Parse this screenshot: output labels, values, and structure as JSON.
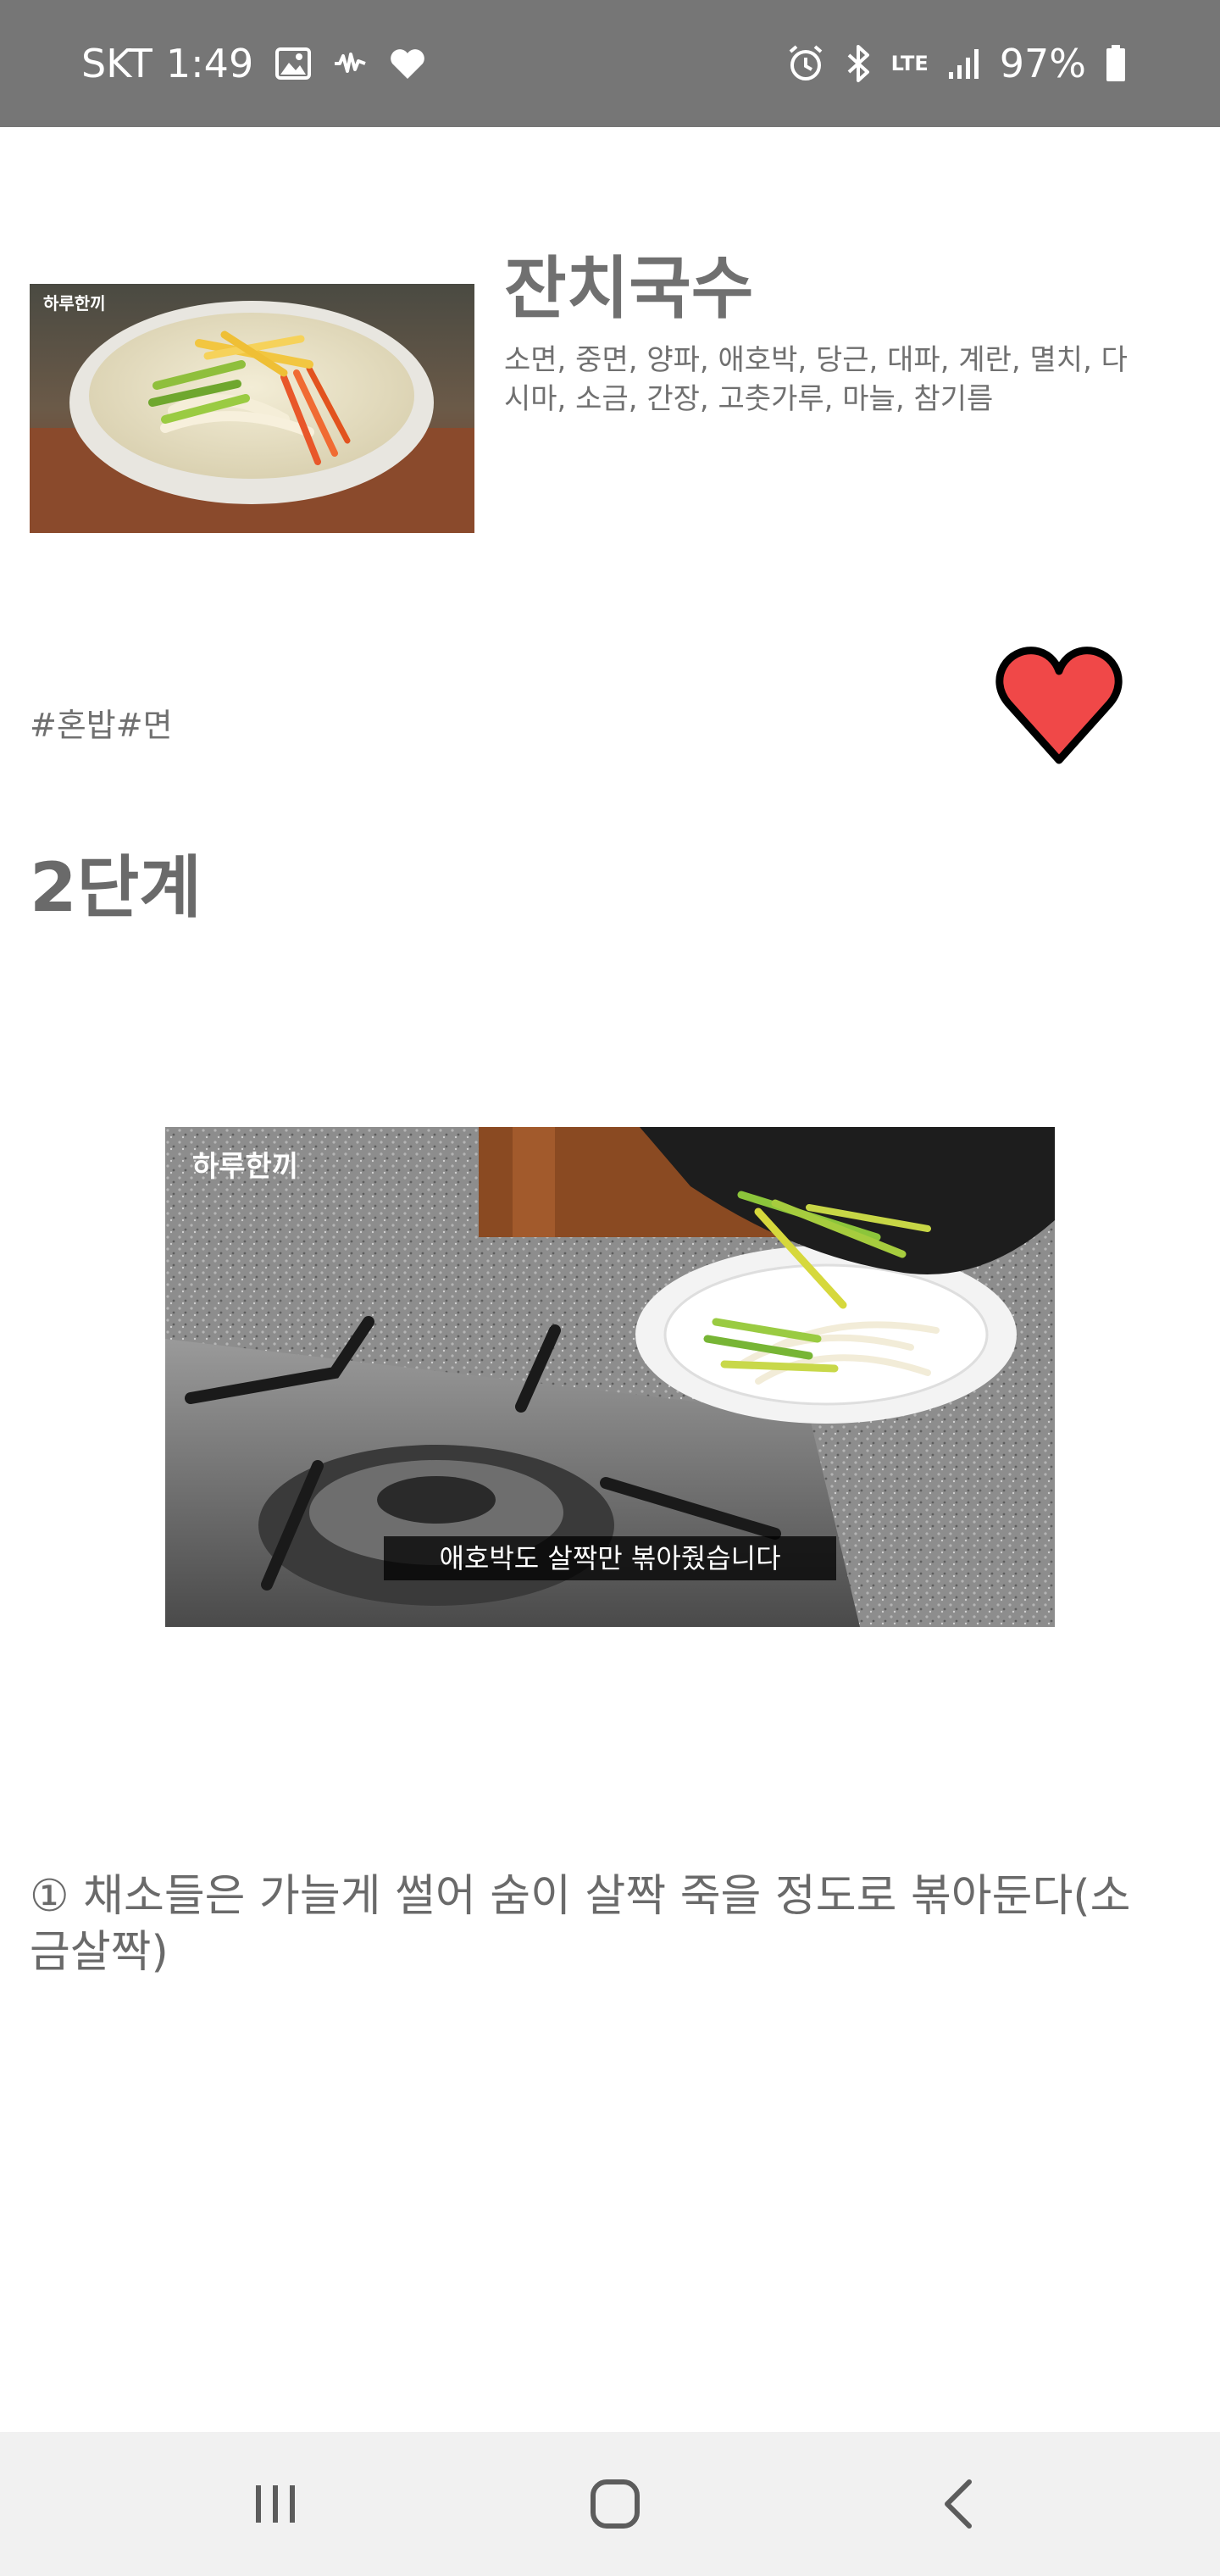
{
  "status_bar": {
    "carrier": "SKT",
    "time": "1:49",
    "lte": "LTE",
    "battery": "97%"
  },
  "recipe": {
    "title": "잔치국수",
    "ingredients": "소면, 중면, 양파, 애호박, 당근, 대파, 계란, 멸치, 다시마, 소금, 간장, 고춧가루, 마늘, 참기름",
    "thumbnail_watermark": "하루한끼",
    "tags": "#혼밥#면",
    "favorite_color": "#f04848"
  },
  "step": {
    "title": "2단계",
    "image_watermark": "하루한끼",
    "image_caption": "애호박도 살짝만 볶아줬습니다",
    "instruction": "① 채소들은 가늘게 썰어 숨이 살짝 죽을 정도로 볶아둔다(소금살짝)"
  },
  "icons": {
    "status_left": [
      "image-icon",
      "activity-icon",
      "heart-small-icon"
    ],
    "status_right": [
      "alarm-icon",
      "bluetooth-icon",
      "signal-icon",
      "battery-icon"
    ],
    "nav": [
      "recent-apps-icon",
      "home-icon",
      "back-icon"
    ]
  }
}
